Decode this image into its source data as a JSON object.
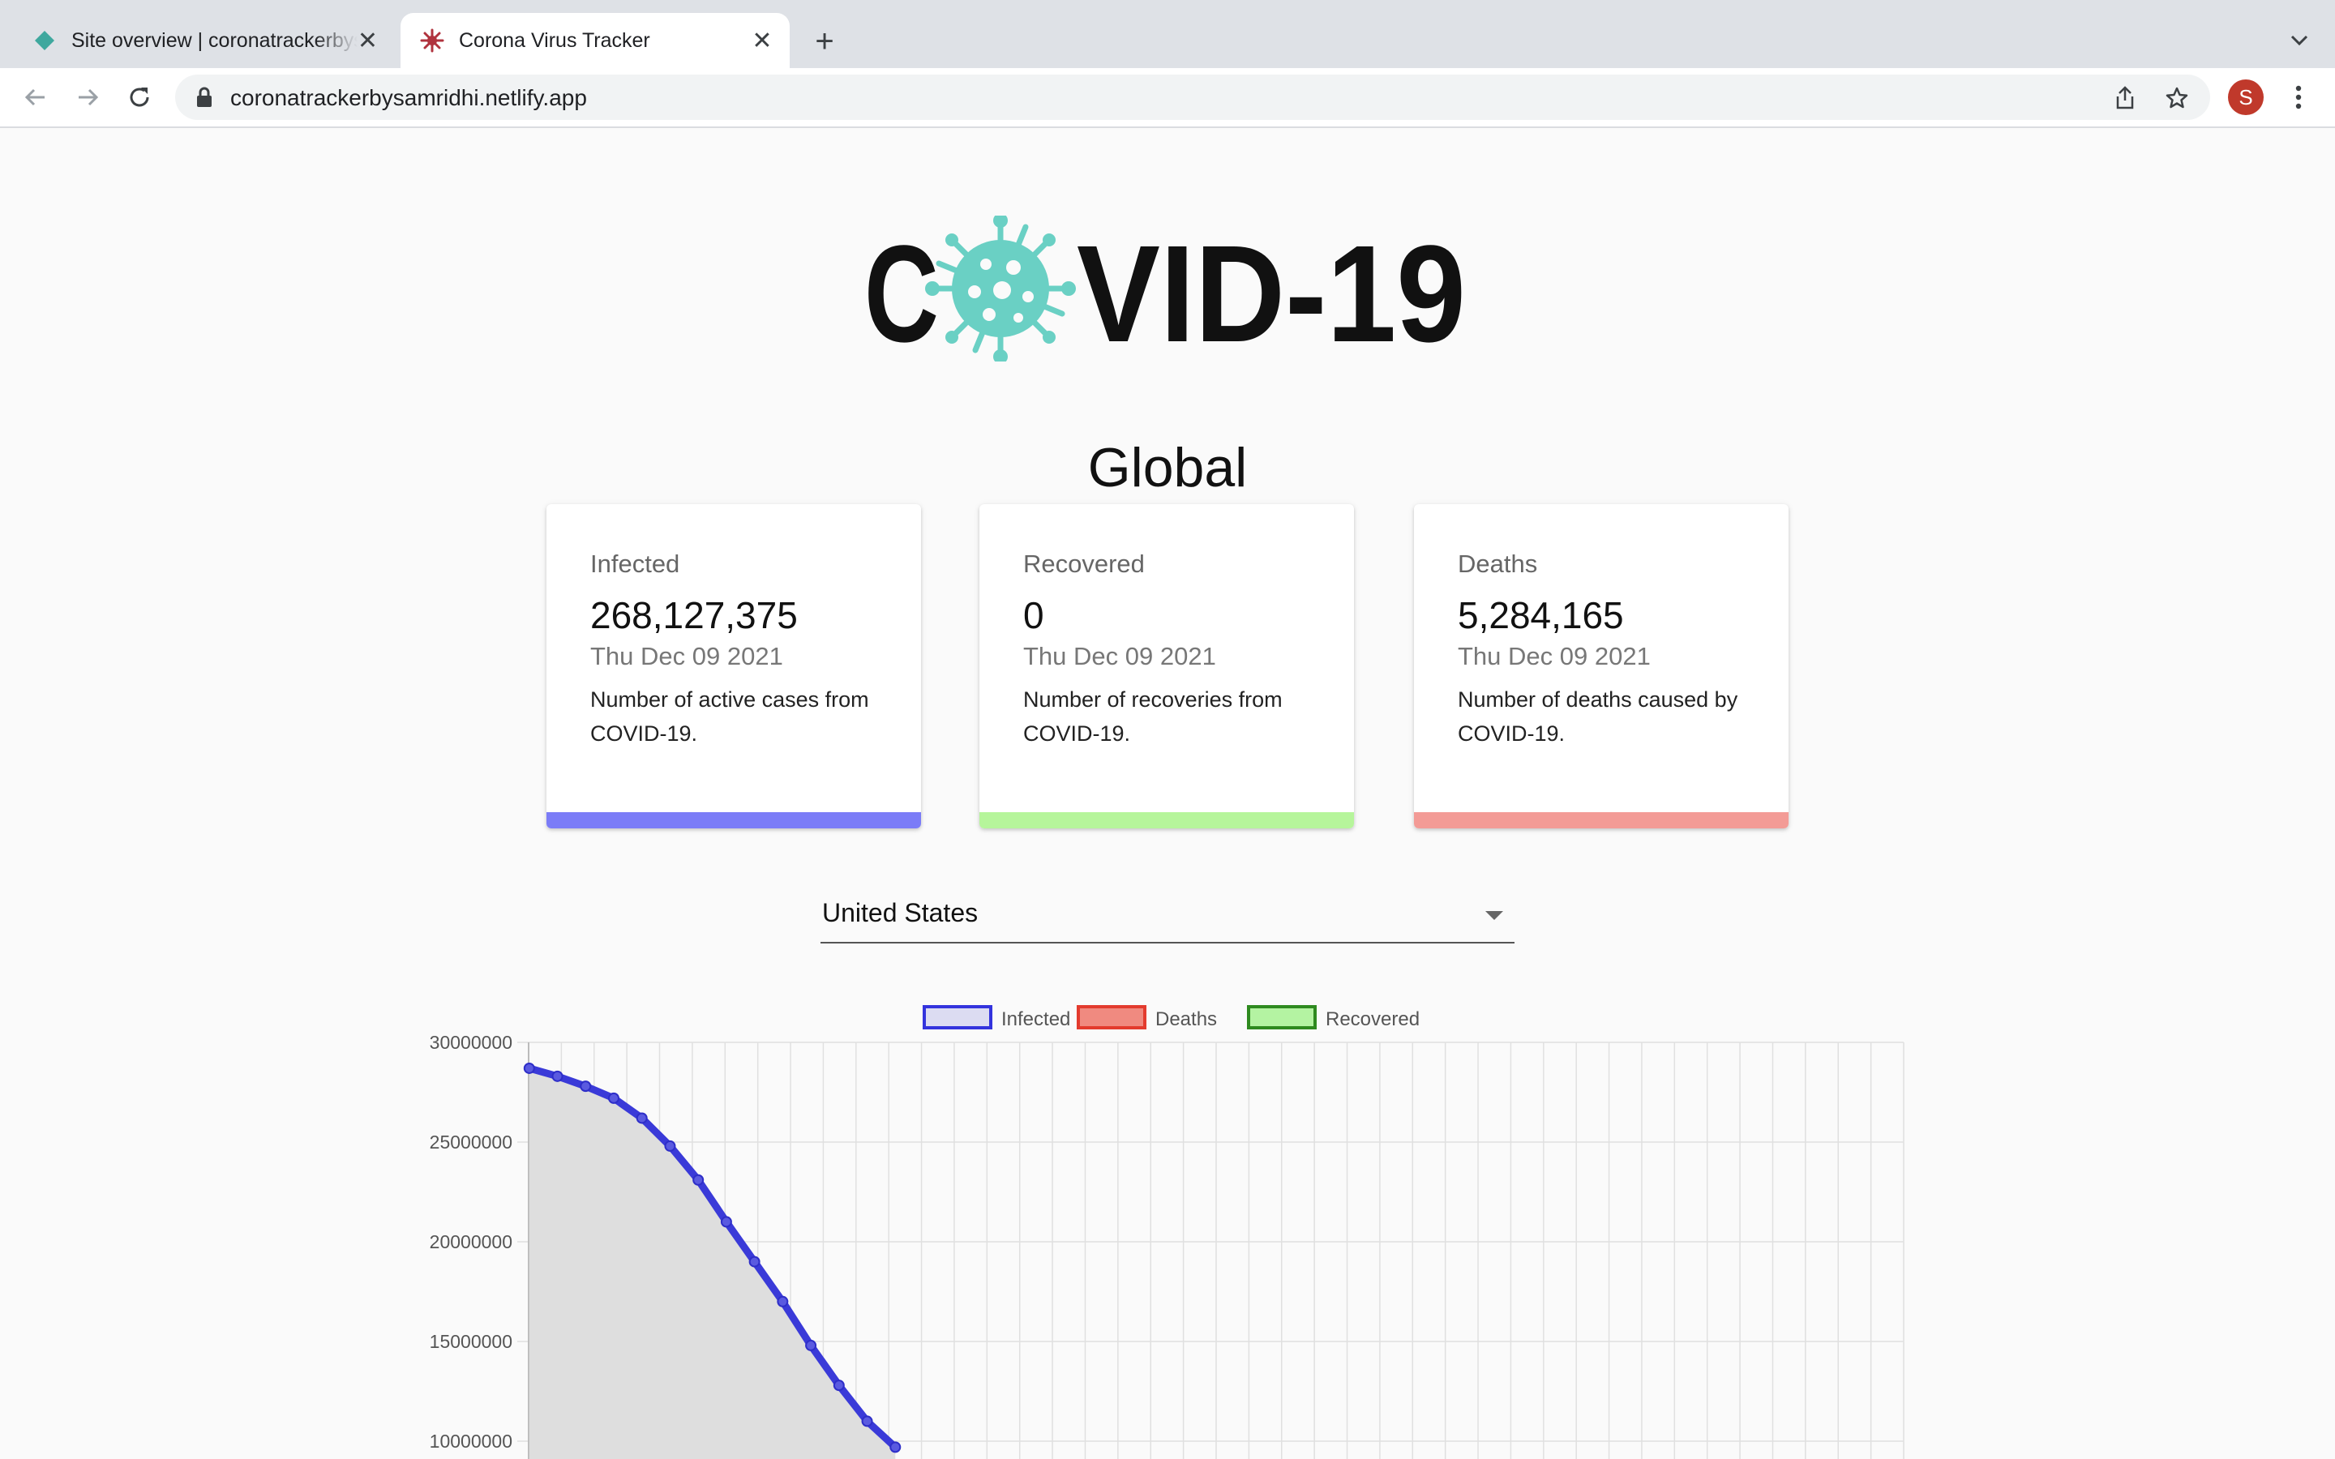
{
  "browser": {
    "tabs": [
      {
        "title": "Site overview | coronatrackerbysamridhi",
        "active": false,
        "favicon": "netlify-diamond-icon"
      },
      {
        "title": "Corona Virus Tracker",
        "active": true,
        "favicon": "virus-icon"
      }
    ],
    "url": "coronatrackerbysamridhi.netlify.app",
    "avatar_letter": "S"
  },
  "page": {
    "logo_text": "COVID-19",
    "heading": "Global",
    "cards": [
      {
        "label": "Infected",
        "value": "268,127,375",
        "date": "Thu Dec 09 2021",
        "description": "Number of active cases from COVID-19.",
        "color": "#7b7cf7"
      },
      {
        "label": "Recovered",
        "value": "0",
        "date": "Thu Dec 09 2021",
        "description": "Number of recoveries from COVID-19.",
        "color": "#b6f59b"
      },
      {
        "label": "Deaths",
        "value": "5,284,165",
        "date": "Thu Dec 09 2021",
        "description": "Number of deaths caused by COVID-19.",
        "color": "#f39b96"
      }
    ],
    "country_select": {
      "selected": "United States"
    }
  },
  "chart_data": {
    "type": "line",
    "legend": [
      {
        "name": "Infected",
        "border": "#3333dd",
        "fill": "#dcdcf2"
      },
      {
        "name": "Deaths",
        "border": "#e33b2e",
        "fill": "#f08a80"
      },
      {
        "name": "Recovered",
        "border": "#2e8a1f",
        "fill": "#b4f3a2"
      }
    ],
    "legend_position": "top",
    "y_ticks": [
      "30000000",
      "25000000",
      "20000000",
      "15000000",
      "10000000"
    ],
    "ylim": [
      10000000,
      30000000
    ],
    "grid": true,
    "series": [
      {
        "name": "Infected",
        "x": [
          0,
          1,
          2,
          3,
          4,
          5,
          6,
          7,
          8,
          9,
          10,
          11,
          12,
          13
        ],
        "values": [
          28700000,
          28300000,
          27800000,
          27200000,
          26200000,
          24800000,
          23100000,
          21000000,
          19000000,
          17000000,
          14800000,
          12800000,
          11000000,
          9700000
        ]
      }
    ],
    "x_count": 42
  }
}
